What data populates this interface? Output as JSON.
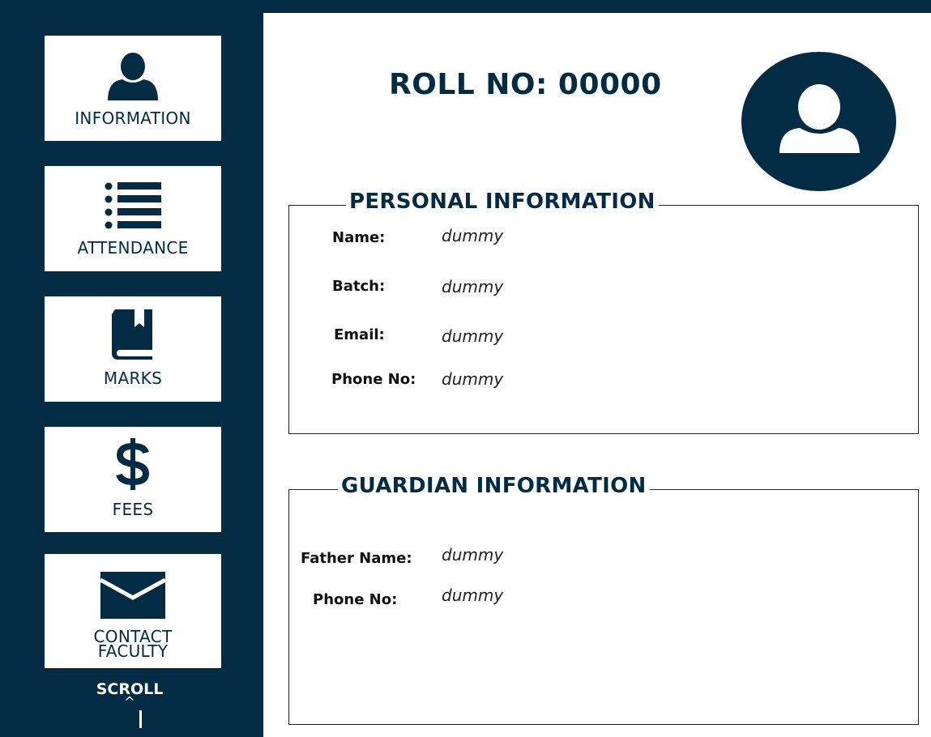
{
  "sidebar": {
    "items": [
      {
        "label": "INFORMATION",
        "icon": "user-icon"
      },
      {
        "label": "ATTENDANCE",
        "icon": "list-icon"
      },
      {
        "label": "MARKS",
        "icon": "book-icon"
      },
      {
        "label": "FEES",
        "icon": "dollar-icon"
      },
      {
        "label_line1": "CONTACT",
        "label_line2": "FACULTY",
        "icon": "envelope-icon"
      }
    ],
    "scroll_label": "SCROLL",
    "scroll_caret": "^"
  },
  "header": {
    "roll_title": "ROLL NO: 00000"
  },
  "personal": {
    "legend": "PERSONAL INFORMATION",
    "fields": [
      {
        "label": "Name:",
        "value": "dummy"
      },
      {
        "label": "Batch:",
        "value": "dummy"
      },
      {
        "label": "Email:",
        "value": "dummy"
      },
      {
        "label": "Phone No:",
        "value": "dummy"
      }
    ]
  },
  "guardian": {
    "legend": "GUARDIAN INFORMATION",
    "fields": [
      {
        "label": "Father Name:",
        "value": "dummy"
      },
      {
        "label": "Phone No:",
        "value": "dummy"
      }
    ]
  },
  "colors": {
    "primary": "#032b43",
    "background": "#ffffff"
  }
}
